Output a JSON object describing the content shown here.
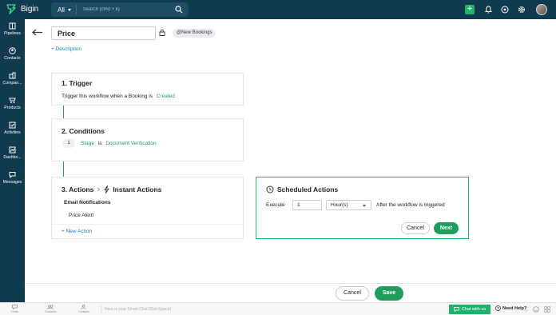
{
  "app": {
    "name": "Bigin"
  },
  "search": {
    "scope": "All",
    "placeholder": "Search (cmd + k)"
  },
  "sidebar": {
    "items": [
      {
        "label": "Pipelines",
        "icon": "pipelines-icon"
      },
      {
        "label": "Contacts",
        "icon": "contacts-icon"
      },
      {
        "label": "Compan...",
        "icon": "companies-icon"
      },
      {
        "label": "Products",
        "icon": "products-icon"
      },
      {
        "label": "Activities",
        "icon": "activities-icon"
      },
      {
        "label": "Dashbo...",
        "icon": "dashboards-icon"
      },
      {
        "label": "Messages",
        "icon": "messages-icon"
      }
    ]
  },
  "workflow": {
    "name": "Price",
    "module_tag": "@New Bookings",
    "add_description": "+ Description"
  },
  "trigger": {
    "title": "1. Trigger",
    "text": "Trigger this workflow when a Booking is",
    "event": "Created"
  },
  "conditions": {
    "title": "2. Conditions",
    "number": "1",
    "field": "Stage",
    "operator": "is",
    "value": "Document Verification"
  },
  "actions": {
    "title": "3. Actions",
    "instant_label": "Instant Actions",
    "section": "Email Notifications",
    "item": "Price Alert!",
    "add_new": "+ New Action"
  },
  "scheduled": {
    "title": "Scheduled Actions",
    "execute_label": "Execute",
    "value": "1",
    "unit": "Hour(s)",
    "suffix": "After the workflow is triggered",
    "cancel": "Cancel",
    "next": "Next"
  },
  "footer": {
    "cancel": "Cancel",
    "save": "Save"
  },
  "bottombar": {
    "items": [
      "Chats",
      "Channels",
      "Contacts"
    ],
    "smart_placeholder": "Here is your Smart Chat (Ctrl+Space)",
    "chat_with_us": "Chat with us",
    "need_help": "Need Help?"
  },
  "colors": {
    "brand_dark": "#103a4e",
    "accent_green": "#1e9d5d",
    "link_blue": "#1a7fb8"
  }
}
